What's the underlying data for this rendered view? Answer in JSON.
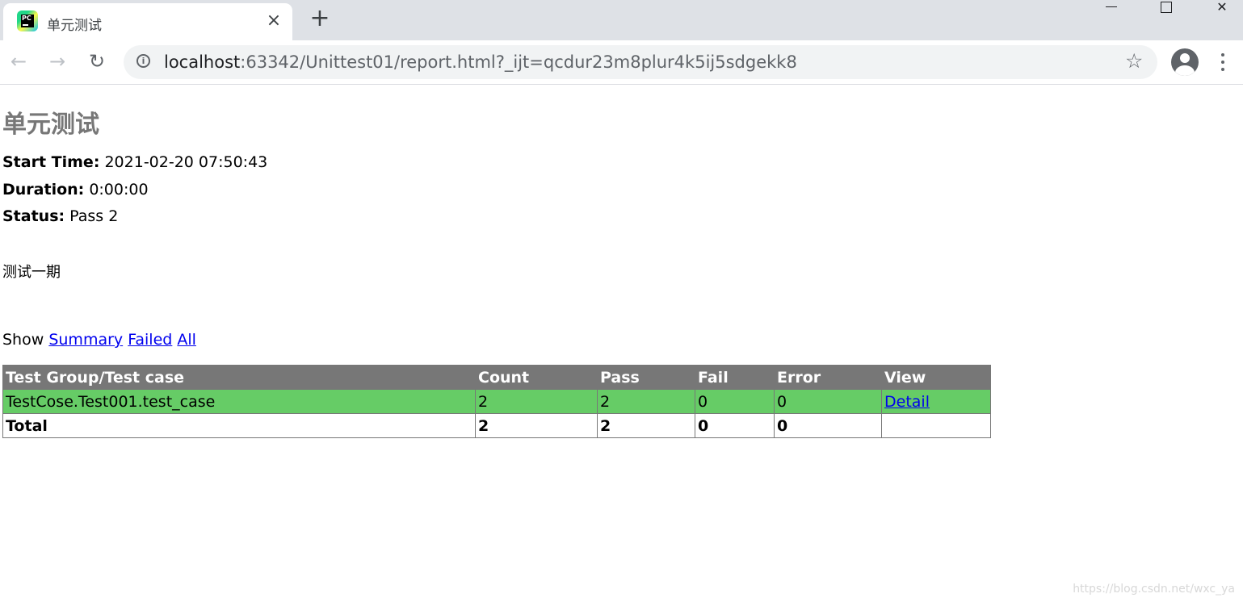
{
  "browser": {
    "tab_title": "单元测试",
    "url_host": "localhost",
    "url_rest": ":63342/Unittest01/report.html?_ijt=qcdur23m8plur4k5ij5sdgekk8"
  },
  "report": {
    "heading": "单元测试",
    "start_time_label": "Start Time:",
    "start_time": "2021-02-20 07:50:43",
    "duration_label": "Duration:",
    "duration": "0:00:00",
    "status_label": "Status:",
    "status": "Pass 2",
    "description": "测试一期",
    "show_label": "Show",
    "filters": [
      "Summary",
      "Failed",
      "All"
    ]
  },
  "table": {
    "headers": [
      "Test Group/Test case",
      "Count",
      "Pass",
      "Fail",
      "Error",
      "View"
    ],
    "rows": [
      {
        "name": "TestCose.Test001.test_case",
        "count": "2",
        "pass": "2",
        "fail": "0",
        "error": "0",
        "view": "Detail"
      }
    ],
    "total": {
      "name": "Total",
      "count": "2",
      "pass": "2",
      "fail": "0",
      "error": "0",
      "view": ""
    }
  },
  "colors": {
    "header_bg": "#777777",
    "pass_row_bg": "#66cc66",
    "link": "#0000ee"
  },
  "watermark": "https://blog.csdn.net/wxc_ya"
}
